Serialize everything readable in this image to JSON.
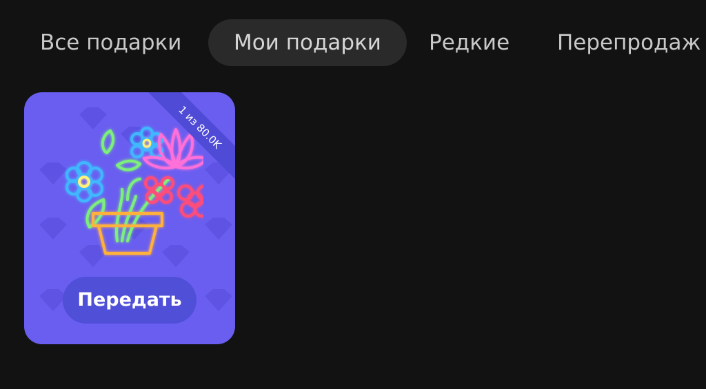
{
  "tabs": [
    {
      "label": "Все подарки",
      "active": false
    },
    {
      "label": "Мои подарки",
      "active": true
    },
    {
      "label": "Редкие",
      "active": false
    },
    {
      "label": "Перепродаж",
      "active": false
    }
  ],
  "gift": {
    "edition_badge": "1 из 80.0K",
    "action_label": "Передать",
    "card_color": "#6a5ef0",
    "button_color": "#4f4fd8",
    "art_icon": "neon-flower-pot-icon"
  }
}
